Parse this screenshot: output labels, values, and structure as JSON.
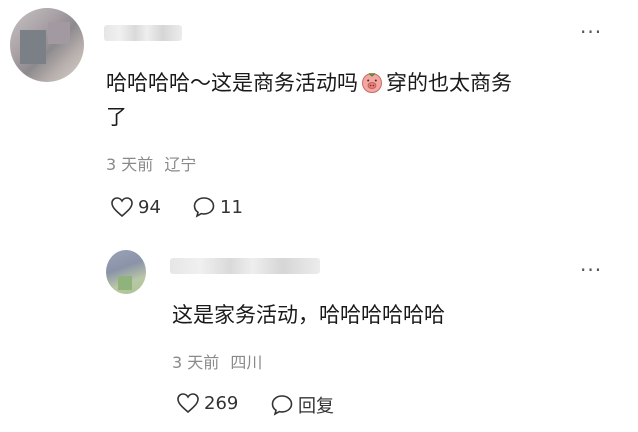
{
  "comment": {
    "text_line1": "哈哈哈哈～这是商务活动吗",
    "emoji_name": "pig-face-emoji",
    "text_tail": "穿的也太商务",
    "text_line2": "了",
    "time": "3 天前",
    "location": "辽宁",
    "likes": "94",
    "replies": "11"
  },
  "reply": {
    "text": "这是家务活动，哈哈哈哈哈哈",
    "time": "3 天前",
    "location": "四川",
    "likes": "269",
    "reply_label": "回复"
  },
  "icons": {
    "more": "more-options-icon",
    "like": "heart-outline-icon",
    "comment": "comment-bubble-icon"
  }
}
